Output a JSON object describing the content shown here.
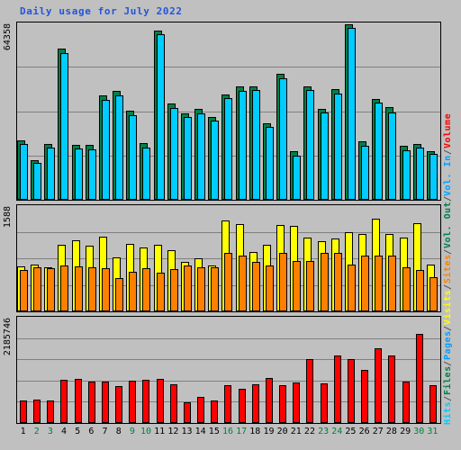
{
  "title": "Daily usage for July 2022",
  "title_color": "#2255dd",
  "axis_labels": {
    "hits_max": "64358",
    "visits_max": "1588",
    "volume_max": "2185746"
  },
  "legend": {
    "entries": [
      {
        "label": "Hits",
        "color": "#00ccff"
      },
      {
        "label": "Files",
        "color": "#00804a"
      },
      {
        "label": "Pages",
        "color": "#00a0ff"
      },
      {
        "label": "Visits",
        "color": "#ffff00"
      },
      {
        "label": "Sites",
        "color": "#ff8000"
      },
      {
        "label": "Vol. Out",
        "color": "#00804a"
      },
      {
        "label": "Vol. In",
        "color": "#00a0ff"
      },
      {
        "label": "Volume",
        "color": "#ff0000"
      }
    ],
    "separator": " / "
  },
  "x_axis": {
    "days": [
      1,
      2,
      3,
      4,
      5,
      6,
      7,
      8,
      9,
      10,
      11,
      12,
      13,
      14,
      15,
      16,
      17,
      18,
      19,
      20,
      21,
      22,
      23,
      24,
      25,
      26,
      27,
      28,
      29,
      30,
      31
    ],
    "weekend_days": [
      2,
      3,
      9,
      10,
      16,
      17,
      23,
      24,
      30,
      31
    ],
    "weekday_color": "#000000",
    "weekend_color": "#008040"
  },
  "chart_data": [
    {
      "type": "bar",
      "title": "Daily usage for July 2022",
      "panel": "hits-files",
      "xlabel": "",
      "ylabel": "Hits / Files",
      "ylim": [
        0,
        64358
      ],
      "grid": true,
      "gridlines": [
        16090,
        32179,
        48269
      ],
      "categories": [
        1,
        2,
        3,
        4,
        5,
        6,
        7,
        8,
        9,
        10,
        11,
        12,
        13,
        14,
        15,
        16,
        17,
        18,
        19,
        20,
        21,
        22,
        23,
        24,
        25,
        26,
        27,
        28,
        29,
        30,
        31
      ],
      "series": [
        {
          "name": "Files",
          "color": "#00804a",
          "values": [
            21600,
            14500,
            20200,
            54800,
            20000,
            19800,
            37900,
            39600,
            32200,
            20500,
            61500,
            35000,
            31500,
            33000,
            30200,
            38300,
            41100,
            41300,
            27900,
            45700,
            17500,
            41300,
            33100,
            40200,
            63800,
            21100,
            36600,
            33500,
            19500,
            20300,
            17800
          ]
        },
        {
          "name": "Hits",
          "color": "#00ccff",
          "values": [
            20100,
            13300,
            19000,
            53200,
            18600,
            18300,
            36400,
            38000,
            30800,
            19100,
            60000,
            33400,
            30000,
            31500,
            28700,
            37000,
            39600,
            39800,
            26300,
            44200,
            16100,
            39800,
            31600,
            38700,
            62300,
            19700,
            35200,
            31800,
            18100,
            19100,
            16500
          ]
        }
      ]
    },
    {
      "type": "bar",
      "panel": "visits-sites",
      "xlabel": "",
      "ylabel": "Sites / Visits",
      "ylim": [
        0,
        1588
      ],
      "grid": true,
      "gridlines": [
        397,
        794,
        1191
      ],
      "categories": [
        1,
        2,
        3,
        4,
        5,
        6,
        7,
        8,
        9,
        10,
        11,
        12,
        13,
        14,
        15,
        16,
        17,
        18,
        19,
        20,
        21,
        22,
        23,
        24,
        25,
        26,
        27,
        28,
        29,
        30,
        31
      ],
      "series": [
        {
          "name": "Visits",
          "color": "#ffff00",
          "values": [
            678,
            700,
            665,
            1000,
            1060,
            985,
            1120,
            810,
            1010,
            960,
            995,
            920,
            735,
            790,
            690,
            1360,
            1310,
            885,
            1000,
            1290,
            1280,
            1100,
            1055,
            1085,
            1190,
            1155,
            1390,
            1155,
            1110,
            1320,
            705
          ]
        },
        {
          "name": "Sites",
          "color": "#ff8000",
          "values": [
            620,
            660,
            645,
            680,
            670,
            665,
            645,
            500,
            590,
            650,
            580,
            630,
            680,
            655,
            655,
            870,
            840,
            735,
            690,
            870,
            760,
            760,
            880,
            870,
            700,
            830,
            830,
            835,
            660,
            620,
            510
          ]
        }
      ]
    },
    {
      "type": "bar",
      "panel": "volume",
      "xlabel": "",
      "ylabel": "Volume / Vol. In / Vol. Out",
      "ylim": [
        0,
        2185746
      ],
      "grid": true,
      "gridlines": [
        437149,
        874298,
        1311447,
        1748596
      ],
      "categories": [
        1,
        2,
        3,
        4,
        5,
        6,
        7,
        8,
        9,
        10,
        11,
        12,
        13,
        14,
        15,
        16,
        17,
        18,
        19,
        20,
        21,
        22,
        23,
        24,
        25,
        26,
        27,
        28,
        29,
        30,
        31
      ],
      "series": [
        {
          "name": "Volume",
          "color": "#ff0000",
          "values": [
            460000,
            475000,
            455000,
            880000,
            900000,
            860000,
            850000,
            760000,
            865000,
            890000,
            910000,
            790000,
            420000,
            540000,
            470000,
            780000,
            700000,
            790000,
            930000,
            780000,
            840000,
            1310000,
            815000,
            1390000,
            1320000,
            1090000,
            1540000,
            1380000,
            850000,
            1830000,
            780000
          ]
        }
      ]
    }
  ]
}
